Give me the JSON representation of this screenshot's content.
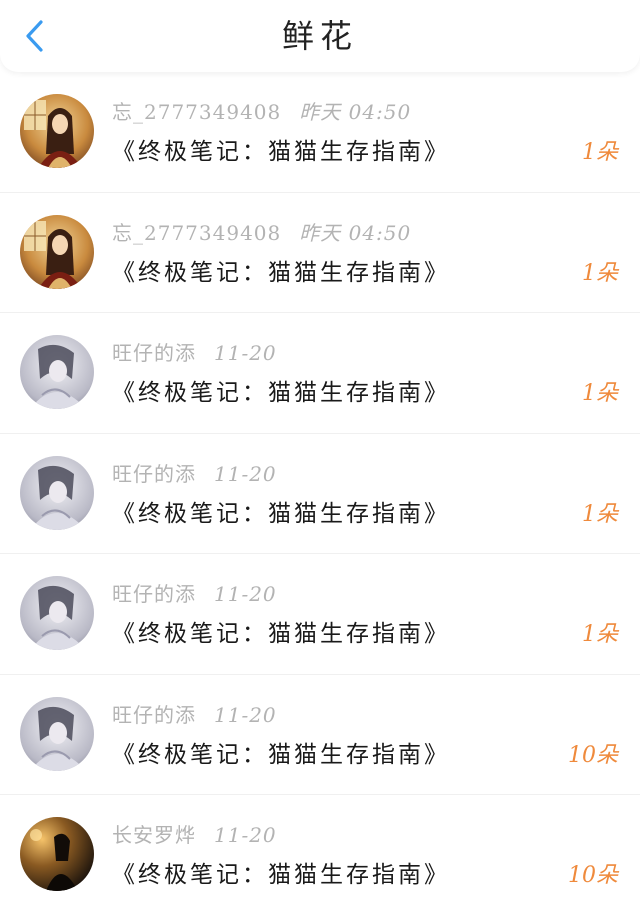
{
  "header": {
    "title": "鲜花",
    "back_icon": "chevron-left-icon",
    "accent": "#3a9bf0"
  },
  "colors": {
    "count": "#ef8a3c",
    "meta": "#b3b3b3"
  },
  "items": [
    {
      "user": "忘_2777349408",
      "time": "昨天 04:50",
      "book": "《终极笔记：猫猫生存指南》",
      "count": "1朵",
      "avatar": "avatar-a"
    },
    {
      "user": "忘_2777349408",
      "time": "昨天 04:50",
      "book": "《终极笔记：猫猫生存指南》",
      "count": "1朵",
      "avatar": "avatar-a"
    },
    {
      "user": "旺仔的添",
      "time": "11-20",
      "book": "《终极笔记：猫猫生存指南》",
      "count": "1朵",
      "avatar": "avatar-b"
    },
    {
      "user": "旺仔的添",
      "time": "11-20",
      "book": "《终极笔记：猫猫生存指南》",
      "count": "1朵",
      "avatar": "avatar-b"
    },
    {
      "user": "旺仔的添",
      "time": "11-20",
      "book": "《终极笔记：猫猫生存指南》",
      "count": "1朵",
      "avatar": "avatar-b"
    },
    {
      "user": "旺仔的添",
      "time": "11-20",
      "book": "《终极笔记：猫猫生存指南》",
      "count": "10朵",
      "avatar": "avatar-b"
    },
    {
      "user": "长安罗烨",
      "time": "11-20",
      "book": "《终极笔记：猫猫生存指南》",
      "count": "10朵",
      "avatar": "avatar-c"
    }
  ]
}
